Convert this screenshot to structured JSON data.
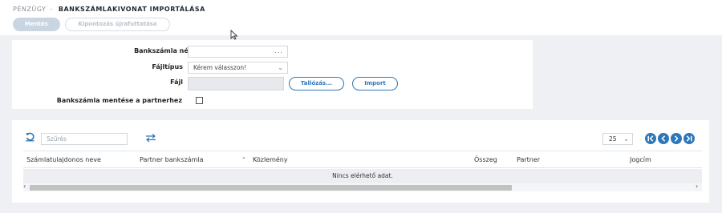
{
  "breadcrumb": {
    "module": "PÉNZÜGY",
    "separator": "-",
    "page": "BANKSZÁMLAKIVONAT IMPORTÁLÁSA"
  },
  "toolbar": {
    "save_label": "Mentés",
    "recalc_label": "Kipontozás újrafuttatása"
  },
  "form": {
    "bank_account_label": "Bankszámla név",
    "bank_account_value": "",
    "bank_account_dots": "...",
    "filetype_label": "Fájltípus",
    "filetype_value": "Kérem válasszon!",
    "file_label": "Fájl",
    "file_value": "",
    "browse_label": "Tallózás...",
    "import_label": "Import",
    "save_partner_label": "Bankszámla mentése a partnerhez",
    "save_partner_checked": false
  },
  "grid": {
    "filter_placeholder": "Szűrés",
    "page_size": "25",
    "columns": [
      "Számlatulajdonos neve",
      "Partner bankszámla",
      "Közlemény",
      "Összeg",
      "Partner",
      "Jogcím"
    ],
    "no_data": "Nincs elérhető adat."
  },
  "colors": {
    "accent": "#2d78b8",
    "disabled_button": "#c9d5e1",
    "background": "#eef0f3"
  }
}
